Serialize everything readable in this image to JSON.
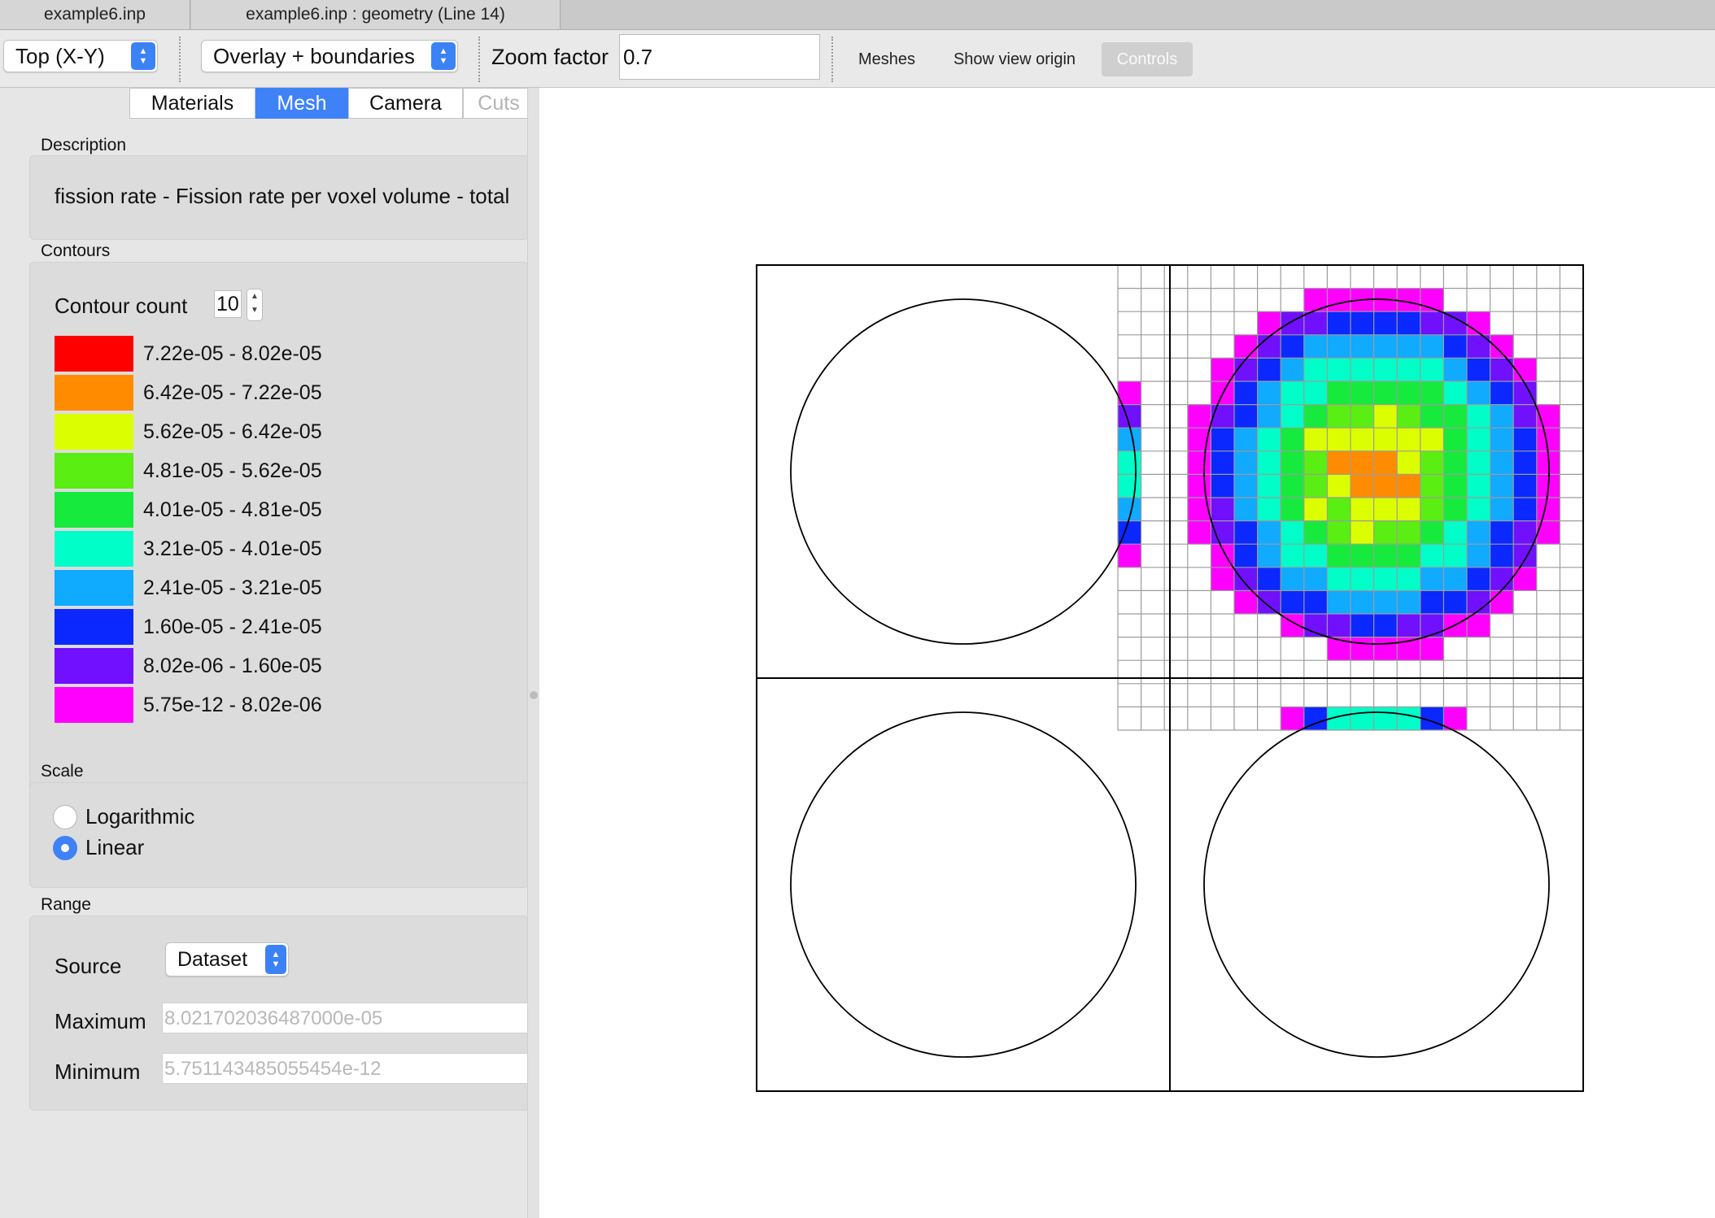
{
  "tabs": [
    {
      "label": "example6.inp"
    },
    {
      "label": "example6.inp : geometry (Line 14)"
    }
  ],
  "toolbar": {
    "view_select": "Top (X-Y)",
    "overlay_select": "Overlay + boundaries",
    "zoom_label": "Zoom factor",
    "zoom_value": "0.7",
    "meshes_button": "Meshes",
    "view_origin_button": "Show view origin",
    "controls_button": "Controls"
  },
  "panel": {
    "tabs": [
      {
        "label": "Materials",
        "active": false
      },
      {
        "label": "Mesh",
        "active": true
      },
      {
        "label": "Camera",
        "active": false
      },
      {
        "label": "Cuts",
        "active": false
      }
    ],
    "description": {
      "label": "Description",
      "text": "fission rate - Fission rate per voxel volume - total"
    },
    "contours": {
      "label": "Contours",
      "count_label": "Contour count",
      "count": "10",
      "levels": [
        {
          "range": "7.22e-05 - 8.02e-05",
          "color": "#ff0000"
        },
        {
          "range": "6.42e-05 - 7.22e-05",
          "color": "#ff8c00"
        },
        {
          "range": "5.62e-05 - 6.42e-05",
          "color": "#dcff00"
        },
        {
          "range": "4.81e-05 - 5.62e-05",
          "color": "#5aee12"
        },
        {
          "range": "4.01e-05 - 4.81e-05",
          "color": "#16ea3c"
        },
        {
          "range": "3.21e-05 - 4.01e-05",
          "color": "#00ffc8"
        },
        {
          "range": "2.41e-05 - 3.21e-05",
          "color": "#10aaff"
        },
        {
          "range": "1.60e-05 - 2.41e-05",
          "color": "#0a28ff"
        },
        {
          "range": "8.02e-06 - 1.60e-05",
          "color": "#7010ff"
        },
        {
          "range": "5.75e-12 - 8.02e-06",
          "color": "#ff00ff"
        }
      ]
    },
    "scale": {
      "label": "Scale",
      "options": [
        {
          "label": "Logarithmic",
          "checked": false
        },
        {
          "label": "Linear",
          "checked": true
        }
      ]
    },
    "range": {
      "label": "Range",
      "source_label": "Source",
      "source_value": "Dataset",
      "max_label": "Maximum",
      "max_value": "8.021702036487000e-05",
      "min_label": "Minimum",
      "min_value": "5.751143485055454e-12"
    }
  }
}
